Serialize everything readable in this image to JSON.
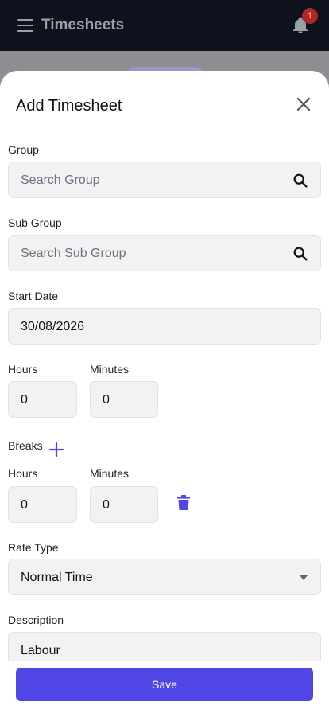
{
  "appbar": {
    "title": "Timesheets",
    "notification_count": "1",
    "menu_icon": "hamburger-icon",
    "bell_icon": "bell-icon"
  },
  "sheet": {
    "title": "Add Timesheet",
    "close_icon": "close-icon",
    "group": {
      "label": "Group",
      "placeholder": "Search Group",
      "icon": "search-icon"
    },
    "sub_group": {
      "label": "Sub Group",
      "placeholder": "Search Sub Group",
      "icon": "search-icon"
    },
    "start_date": {
      "label": "Start Date",
      "value": "30/08/2026"
    },
    "duration": {
      "hours_label": "Hours",
      "hours_value": "0",
      "minutes_label": "Minutes",
      "minutes_value": "0"
    },
    "breaks": {
      "label": "Breaks",
      "add_icon": "plus-icon",
      "hours_label": "Hours",
      "hours_value": "0",
      "minutes_label": "Minutes",
      "minutes_value": "0",
      "delete_icon": "trash-icon"
    },
    "rate_type": {
      "label": "Rate Type",
      "value": "Normal Time"
    },
    "description": {
      "label": "Description",
      "value": "Labour"
    }
  },
  "footer": {
    "save_label": "Save"
  },
  "colors": {
    "accent": "#4f46e5",
    "appbar": "#0d121c",
    "badge": "#b32626"
  }
}
